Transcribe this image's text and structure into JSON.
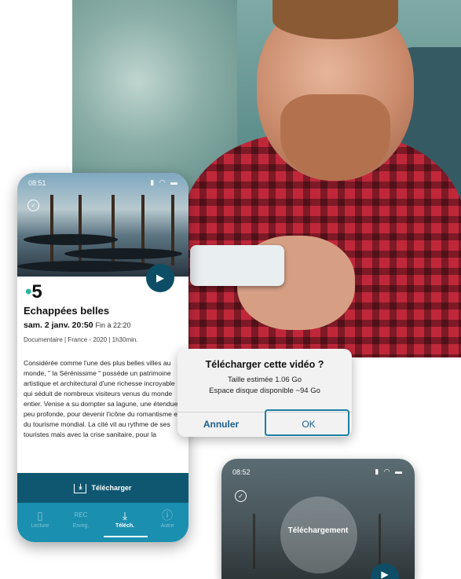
{
  "phone_main": {
    "status_time": "08:51",
    "status_icons": "▮ ◠ ▬",
    "check_icon": "✓",
    "play_icon": "▶",
    "channel_number": "5",
    "channel_dot": "•",
    "title": "Echappées belles",
    "date": "sam. 2 janv. 20:50",
    "end_time": "Fin à 22:20",
    "meta": "Documentaire | France - 2020 | 1h30min.",
    "description": "Considérée comme l'une des plus belles villes au monde, \" la Sérénissime \" possède un patrimoine artistique et architectural d'une richesse incroyable qui séduit de nombreux visiteurs venus du monde entier. Venise a su dompter sa lagune, une étendue peu profonde, pour devenir l'icône du romantisme et du tourisme mondial. La cité vit au rythme de ses touristes mais avec la crise sanitaire, pour la",
    "download_label": "Télécharger",
    "tabs": [
      {
        "label": "Lecture",
        "icon": "phone-icon",
        "glyph": "▯"
      },
      {
        "label": "Enreg.",
        "icon": "rec-icon",
        "glyph": "REC"
      },
      {
        "label": "Téléch.",
        "icon": "download-icon",
        "glyph": "⤓"
      },
      {
        "label": "Autre",
        "icon": "info-icon",
        "glyph": "ⓘ"
      }
    ]
  },
  "dialog": {
    "title": "Télécharger cette vidéo ?",
    "size_line": "Taille estimée 1.06 Go",
    "space_line": "Espace disque disponible ~94 Go",
    "cancel_label": "Annuler",
    "ok_label": "OK"
  },
  "phone_secondary": {
    "status_time": "08:52",
    "status_icons": "▮ ◠ ▬",
    "check_icon": "✓",
    "downloading_label": "Téléchargement",
    "play_icon": "▶"
  },
  "colors": {
    "accent_dark": "#0f5770",
    "tab_bar": "#1a8fb0",
    "channel_dot": "#2cb5a0",
    "highlight_frame": "#1b7fa6"
  }
}
